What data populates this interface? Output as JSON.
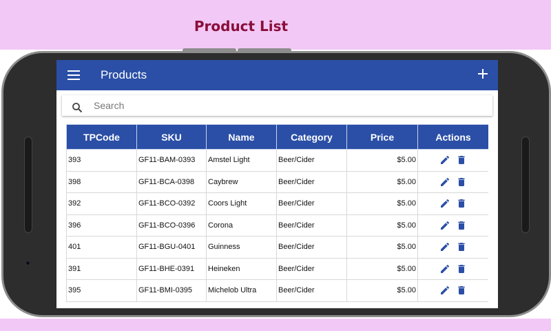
{
  "banner": {
    "title": "Product List"
  },
  "appbar": {
    "title": "Products"
  },
  "search": {
    "placeholder": "Search"
  },
  "table": {
    "headers": [
      "TPCode",
      "SKU",
      "Name",
      "Category",
      "Price",
      "Actions"
    ],
    "rows": [
      [
        "393",
        "GF11-BAM-0393",
        "Amstel Light",
        "Beer/Cider",
        "$5.00"
      ],
      [
        "398",
        "GF11-BCA-0398",
        "Caybrew",
        "Beer/Cider",
        "$5.00"
      ],
      [
        "392",
        "GF11-BCO-0392",
        "Coors Light",
        "Beer/Cider",
        "$5.00"
      ],
      [
        "396",
        "GF11-BCO-0396",
        "Corona",
        "Beer/Cider",
        "$5.00"
      ],
      [
        "401",
        "GF11-BGU-0401",
        "Guinness",
        "Beer/Cider",
        "$5.00"
      ],
      [
        "391",
        "GF11-BHE-0391",
        "Heineken",
        "Beer/Cider",
        "$5.00"
      ],
      [
        "395",
        "GF11-BMI-0395",
        "Michelob Ultra",
        "Beer/Cider",
        "$5.00"
      ]
    ]
  },
  "icons": {
    "menu": "menu-icon",
    "add": "add-icon",
    "search": "search-icon",
    "edit": "edit-pencil-icon",
    "delete": "delete-trash-icon"
  },
  "colors": {
    "primary": "#2b4fa6",
    "banner_bg": "#f2c8f6",
    "banner_text": "#8a0e3a"
  }
}
